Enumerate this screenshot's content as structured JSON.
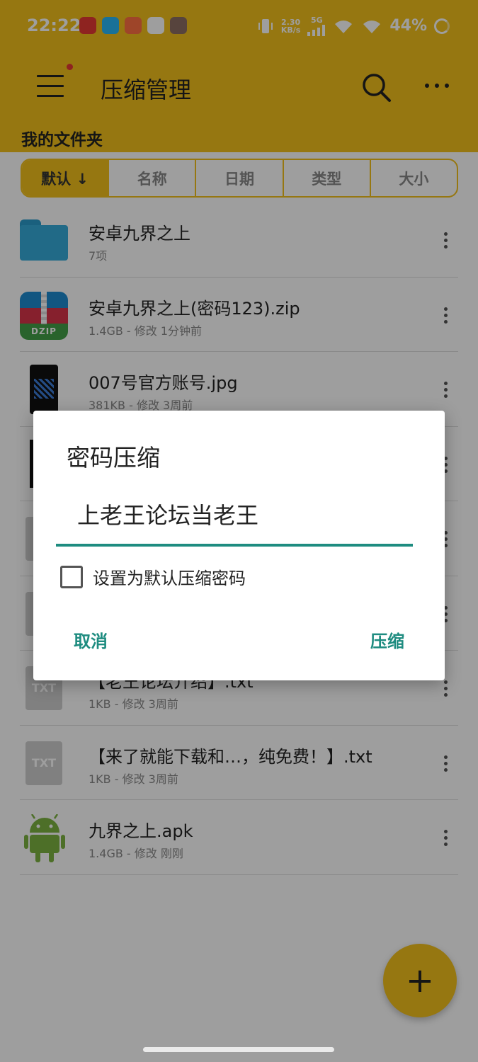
{
  "status_bar": {
    "time": "22:22",
    "net_speed_value": "2.30",
    "net_speed_unit": "KB/s",
    "network_type": "5G",
    "battery_percent": "44%"
  },
  "toolbar": {
    "title": "压缩管理",
    "menu_icon": "menu-icon",
    "search_icon": "search-icon",
    "more_icon": "more-icon"
  },
  "folder_label": "我的文件夹",
  "sort_tabs": [
    {
      "label": "默认 ↓",
      "selected": true
    },
    {
      "label": "名称",
      "selected": false
    },
    {
      "label": "日期",
      "selected": false
    },
    {
      "label": "类型",
      "selected": false
    },
    {
      "label": "大小",
      "selected": false
    }
  ],
  "files": [
    {
      "name": "安卓九界之上",
      "meta": "7项",
      "icon": "folder-icon"
    },
    {
      "name": "安卓九界之上(密码123).zip",
      "meta": "1.4GB - 修改 1分钟前",
      "icon": "zip-icon",
      "icon_text": "DZIP"
    },
    {
      "name": "007号官方账号.jpg",
      "meta": "381KB - 修改 3周前",
      "icon": "image-icon"
    },
    {
      "name": "",
      "meta": "",
      "icon": "image-icon"
    },
    {
      "name": "",
      "meta": "",
      "icon": "txt-icon"
    },
    {
      "name": "",
      "meta": "",
      "icon": "txt-icon"
    },
    {
      "name": "【老王论坛介绍】.txt",
      "meta": "1KB - 修改 3周前",
      "icon": "txt-icon",
      "icon_text": "TXT"
    },
    {
      "name": "【来了就能下载和…，纯免费！】.txt",
      "meta": "1KB - 修改 3周前",
      "icon": "txt-icon",
      "icon_text": "TXT"
    },
    {
      "name": "九界之上.apk",
      "meta": "1.4GB - 修改 刚刚",
      "icon": "android-icon"
    }
  ],
  "dialog": {
    "title": "密码压缩",
    "password_value": "上老王论坛当老王",
    "checkbox_label": "设置为默认压缩密码",
    "checkbox_checked": false,
    "cancel_label": "取消",
    "confirm_label": "压缩"
  },
  "fab": {
    "label": "+"
  },
  "colors": {
    "brand_yellow": "#F2C01C",
    "accent_teal": "#1E8C80"
  }
}
